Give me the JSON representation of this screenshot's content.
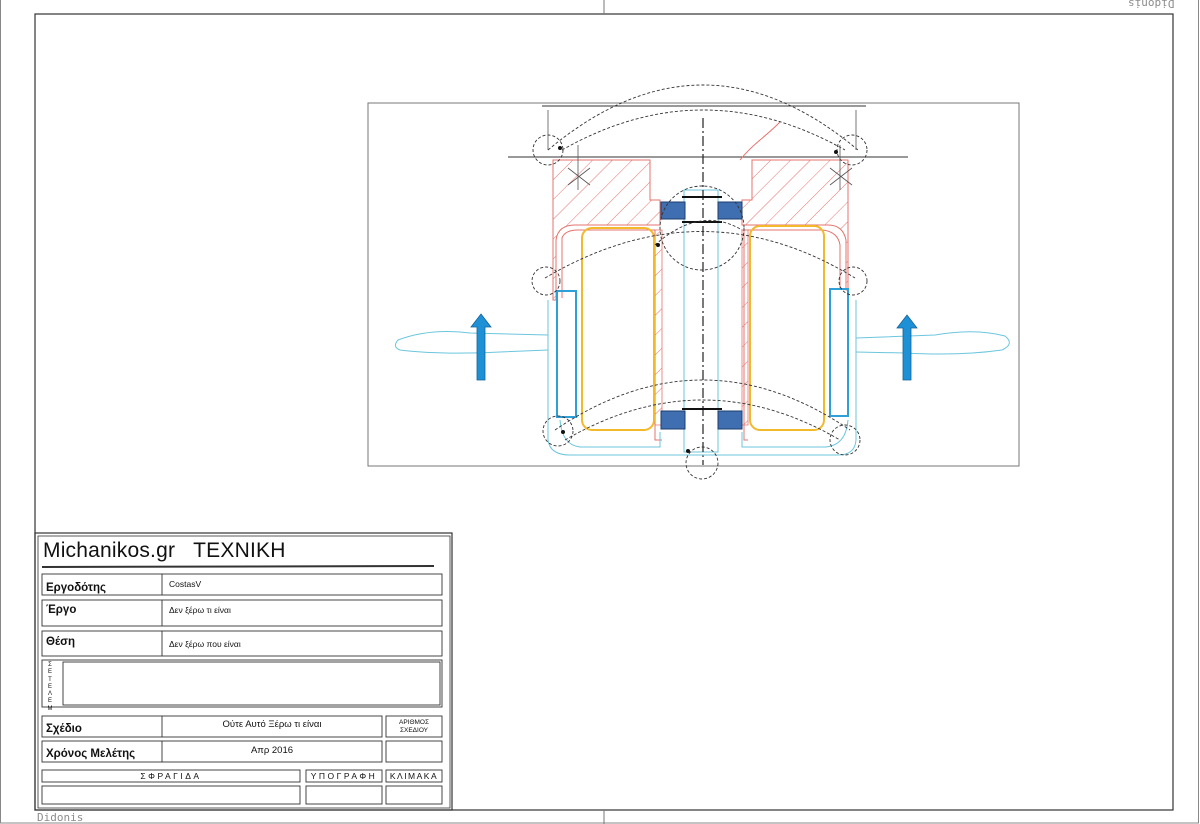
{
  "sheet": {
    "watermark_top": "Didonis",
    "watermark_bottom": "Didonis"
  },
  "title_block": {
    "company": "Michanikos.gr",
    "discipline": "ΤΕΧΝΙΚΗ",
    "fields": {
      "employer_label": "Εργοδότης",
      "employer_value": "CostasV",
      "project_label": "Έργο",
      "project_value": "Δεν ξέρω τι είναι",
      "location_label": "Θέση",
      "location_value": "Δεν ξέρω που είναι",
      "studies_label": "ΜΕΛΕΤΕΣ",
      "drawing_label": "Σχέδιο",
      "drawing_value": "Ούτε Αυτό Ξέρω τι είναι",
      "drawing_number_label_1": "ΑΡΙΘΜΟΣ",
      "drawing_number_label_2": "ΣΧΕΔΙΟΥ",
      "year_label": "Χρόνος Μελέτης",
      "year_value": "Απρ 2016",
      "stamp_label": "ΣΦΡΑΓΙΔΑ",
      "signature_label": "ΥΠΟΓΡΑΦΗ",
      "scale_label": "ΚΛΙΜΑΚΑ"
    }
  },
  "colors": {
    "frame": "#4a4a4a",
    "housing": "#e5736e",
    "coil": "#f2b92b",
    "water": "#6cc6dd",
    "magnet": "#2f9fd8",
    "bearing": "#3f6fb0",
    "arrow": "#1e90d6",
    "dashed": "#333333"
  },
  "icons": [
    "flow-up-arrow-icon",
    "flow-up-arrow-icon"
  ]
}
